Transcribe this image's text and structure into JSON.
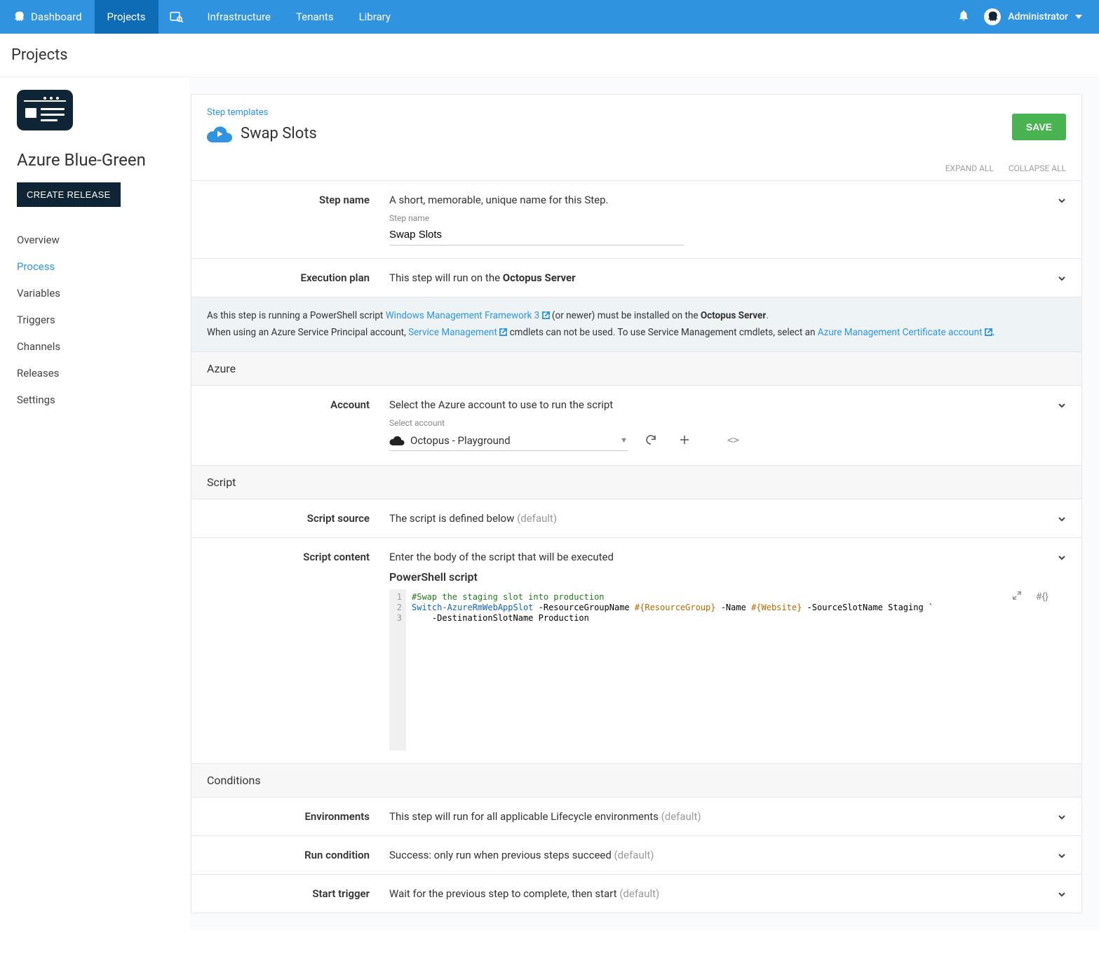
{
  "topnav": {
    "items": [
      "Dashboard",
      "Projects",
      "Infrastructure",
      "Tenants",
      "Library"
    ],
    "user": "Administrator"
  },
  "page_title": "Projects",
  "project": {
    "name": "Azure Blue-Green",
    "create_release": "CREATE RELEASE"
  },
  "side_nav": [
    "Overview",
    "Process",
    "Variables",
    "Triggers",
    "Channels",
    "Releases",
    "Settings"
  ],
  "header": {
    "breadcrumb": "Step templates",
    "title": "Swap Slots",
    "save": "SAVE",
    "expand_all": "EXPAND ALL",
    "collapse_all": "COLLAPSE ALL"
  },
  "step_name": {
    "label": "Step name",
    "desc": "A short, memorable, unique name for this Step.",
    "input_label": "Step name",
    "value": "Swap Slots"
  },
  "exec_plan": {
    "label": "Execution plan",
    "text_pre": "This step will run on the ",
    "text_bold": "Octopus Server"
  },
  "info": {
    "line1_a": "As this step is running a PowerShell script ",
    "link1": "Windows Management Framework 3",
    "line1_b": " (or newer) must be installed on the ",
    "line1_bold": "Octopus Server",
    "line2_a": "When using an Azure Service Principal account, ",
    "link2": "Service Management",
    "line2_b": " cmdlets can not be used. To use Service Management cmdlets, select an ",
    "link3": "Azure Management Certificate account"
  },
  "azure": {
    "header": "Azure",
    "account_label": "Account",
    "account_desc": "Select the Azure account to use to run the script",
    "select_label": "Select account",
    "selected": "Octopus - Playground"
  },
  "script": {
    "header": "Script",
    "source_label": "Script source",
    "source_text": "The script is defined below ",
    "source_default": "(default)",
    "content_label": "Script content",
    "content_desc": "Enter the body of the script that will be executed",
    "ps_heading": "PowerShell script",
    "lines": [
      "1",
      "2",
      "3"
    ],
    "code_comment": "#Swap the staging slot into production",
    "code_cmd": "Switch-AzureRmWebAppSlot",
    "code_p1": " -ResourceGroupName ",
    "code_v1": "#{ResourceGroup}",
    "code_p2": " -Name ",
    "code_v2": "#{Website}",
    "code_p3": " -SourceSlotName Staging `",
    "code_line3": "    -DestinationSlotName Production",
    "var_insert": "#{}"
  },
  "conditions": {
    "header": "Conditions",
    "env_label": "Environments",
    "env_text": "This step will run for all applicable Lifecycle environments ",
    "env_default": "(default)",
    "run_label": "Run condition",
    "run_text": "Success: only run when previous steps succeed ",
    "run_default": "(default)",
    "start_label": "Start trigger",
    "start_text": "Wait for the previous step to complete, then start ",
    "start_default": "(default)"
  }
}
